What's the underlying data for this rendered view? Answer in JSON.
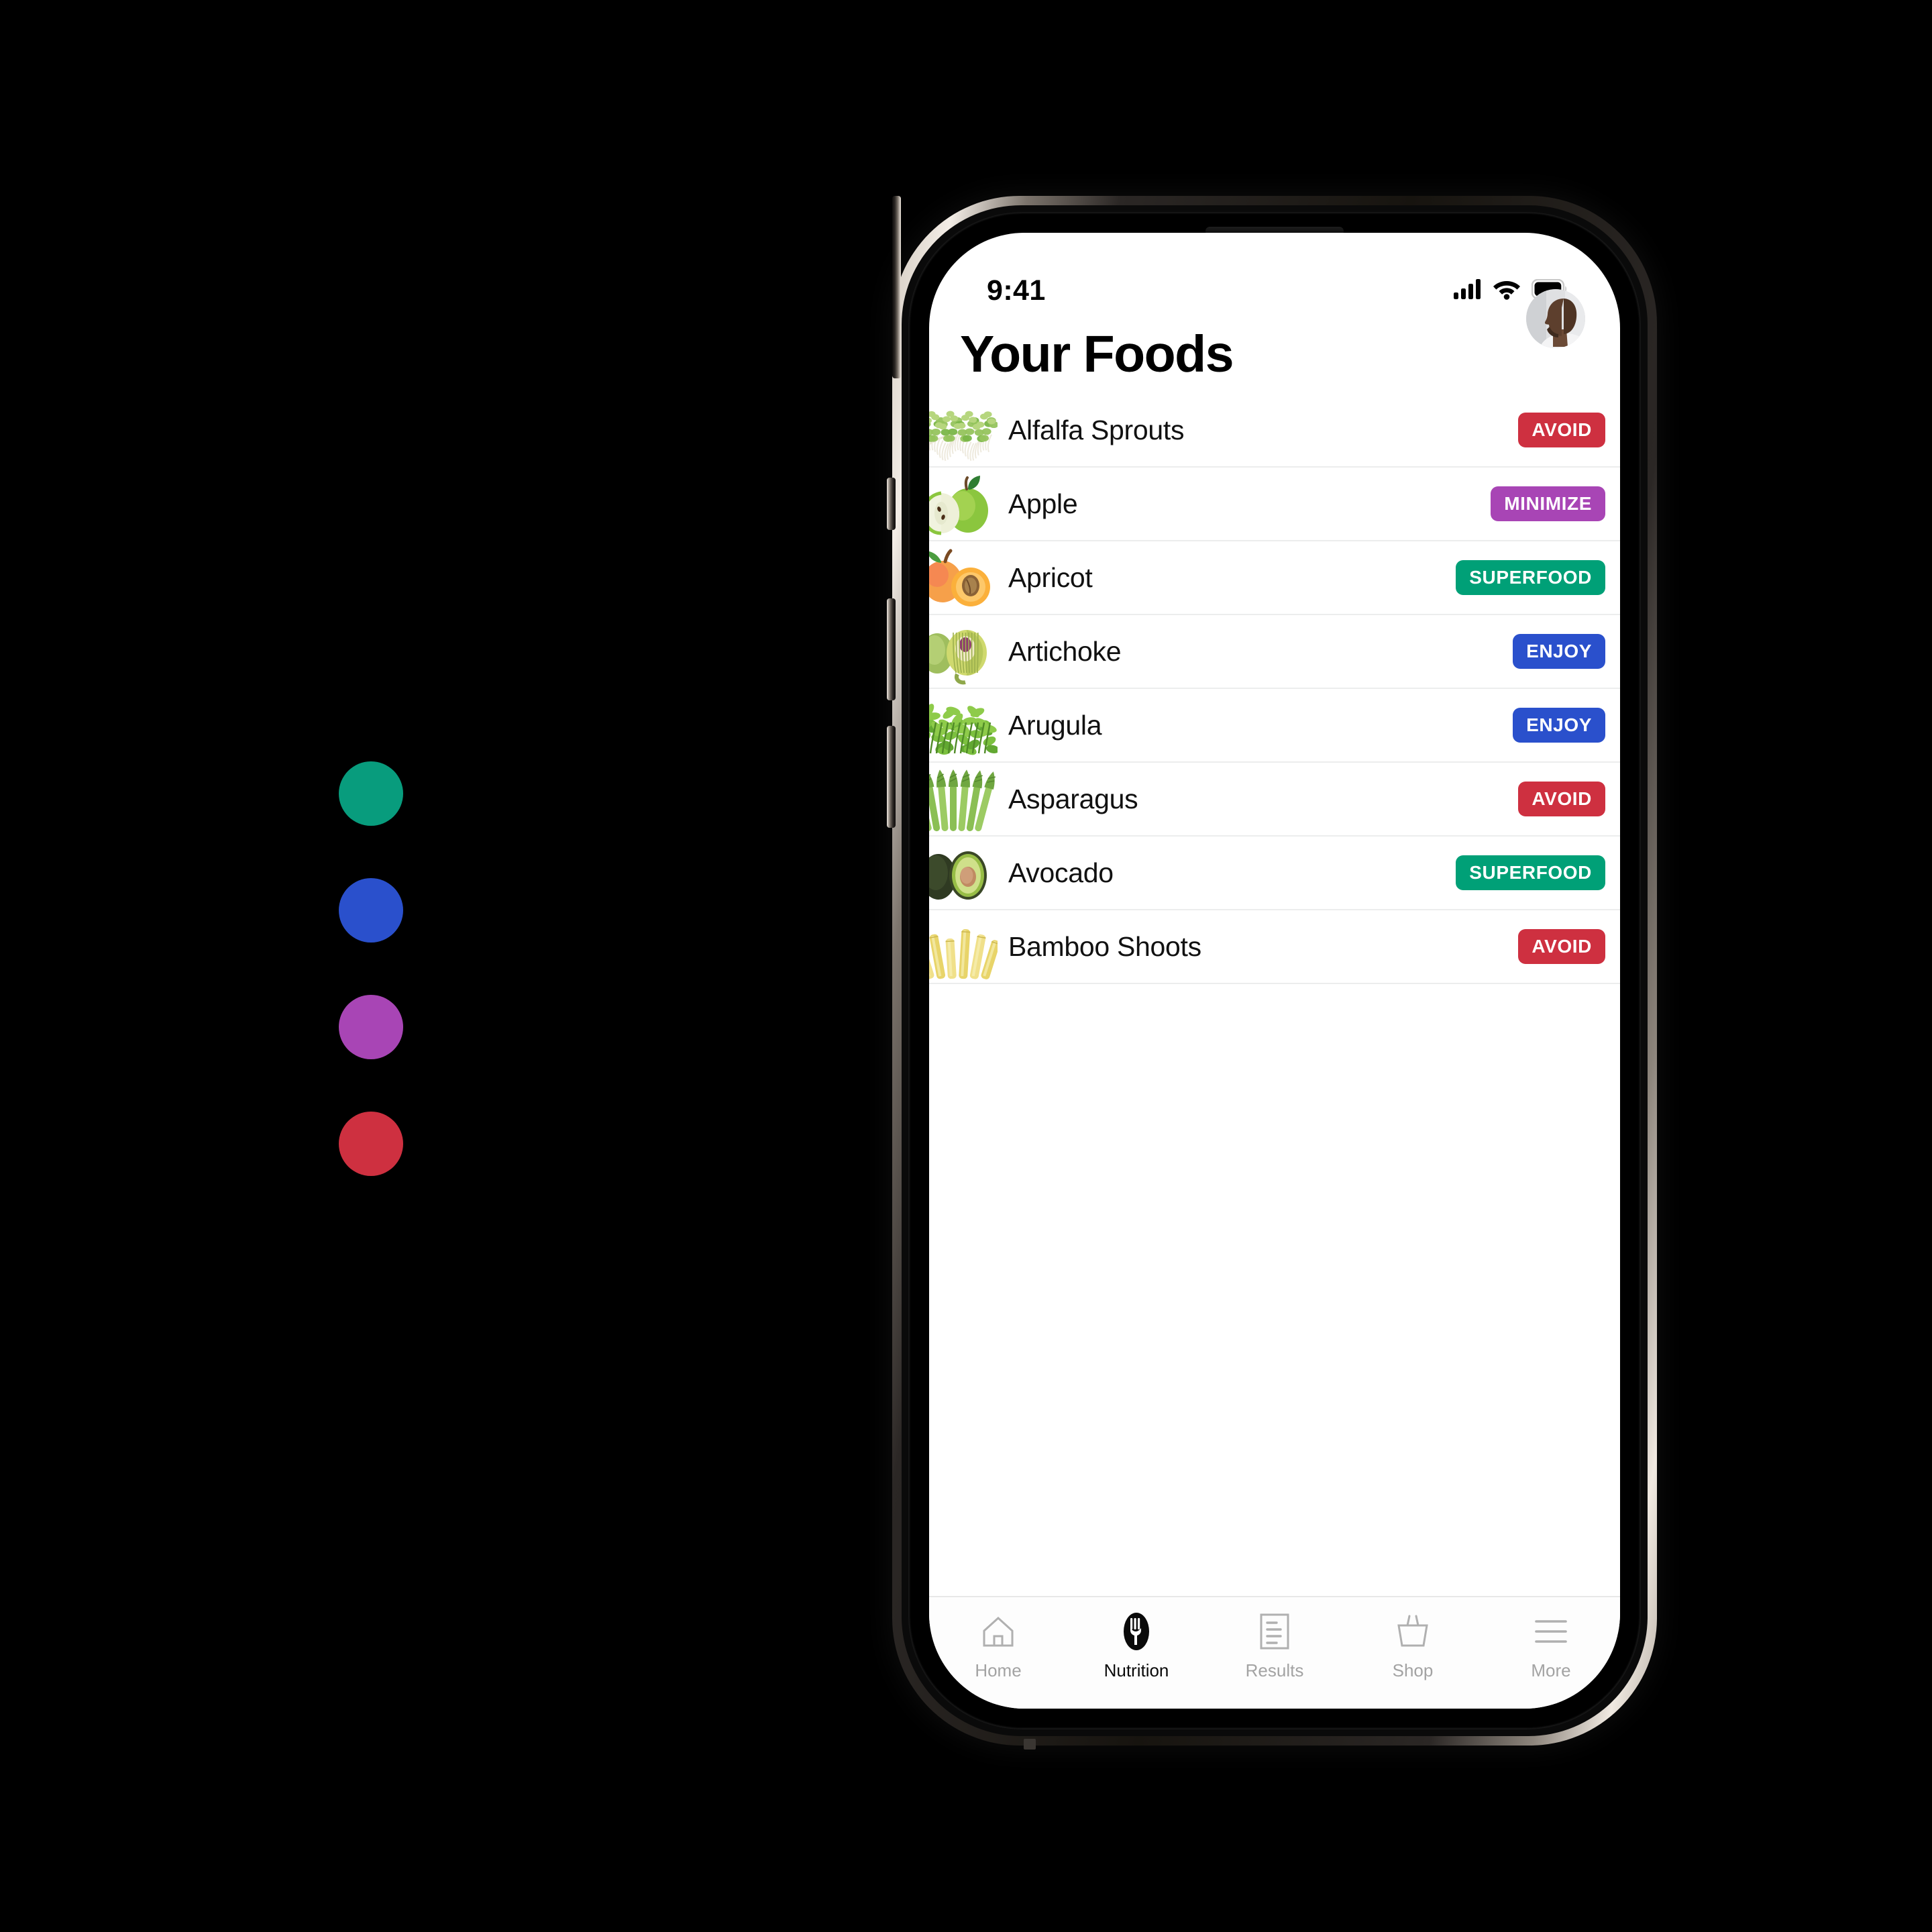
{
  "legend": {
    "dots": [
      {
        "name": "superfood-dot",
        "color": "#089C7D"
      },
      {
        "name": "enjoy-dot",
        "color": "#2A50CC"
      },
      {
        "name": "minimize-dot",
        "color": "#A845B5"
      },
      {
        "name": "avoid-dot",
        "color": "#CE3040"
      }
    ]
  },
  "status_bar": {
    "time": "9:41",
    "cellular_icon": "signal-bars-icon",
    "wifi_icon": "wifi-icon",
    "battery_icon": "battery-icon"
  },
  "header": {
    "title": "Your Foods",
    "avatar_icon": "avatar"
  },
  "badge_colors": {
    "AVOID": "#CE3040",
    "MINIMIZE": "#A845B5",
    "SUPERFOOD": "#00A077",
    "ENJOY": "#2A50CC"
  },
  "food_list": [
    {
      "name": "Alfalfa Sprouts",
      "badge": "AVOID",
      "image": "alfalfa-sprouts-image"
    },
    {
      "name": "Apple",
      "badge": "MINIMIZE",
      "image": "apple-image"
    },
    {
      "name": "Apricot",
      "badge": "SUPERFOOD",
      "image": "apricot-image"
    },
    {
      "name": "Artichoke",
      "badge": "ENJOY",
      "image": "artichoke-image"
    },
    {
      "name": "Arugula",
      "badge": "ENJOY",
      "image": "arugula-image"
    },
    {
      "name": "Asparagus",
      "badge": "AVOID",
      "image": "asparagus-image"
    },
    {
      "name": "Avocado",
      "badge": "SUPERFOOD",
      "image": "avocado-image"
    },
    {
      "name": "Bamboo Shoots",
      "badge": "AVOID",
      "image": "bamboo-shoots-image"
    }
  ],
  "tabbar": {
    "tabs": [
      {
        "label": "Home",
        "icon": "home-icon",
        "active": false
      },
      {
        "label": "Nutrition",
        "icon": "fork-icon",
        "active": true
      },
      {
        "label": "Results",
        "icon": "document-icon",
        "active": false
      },
      {
        "label": "Shop",
        "icon": "basket-icon",
        "active": false
      },
      {
        "label": "More",
        "icon": "hamburger-icon",
        "active": false
      }
    ]
  }
}
